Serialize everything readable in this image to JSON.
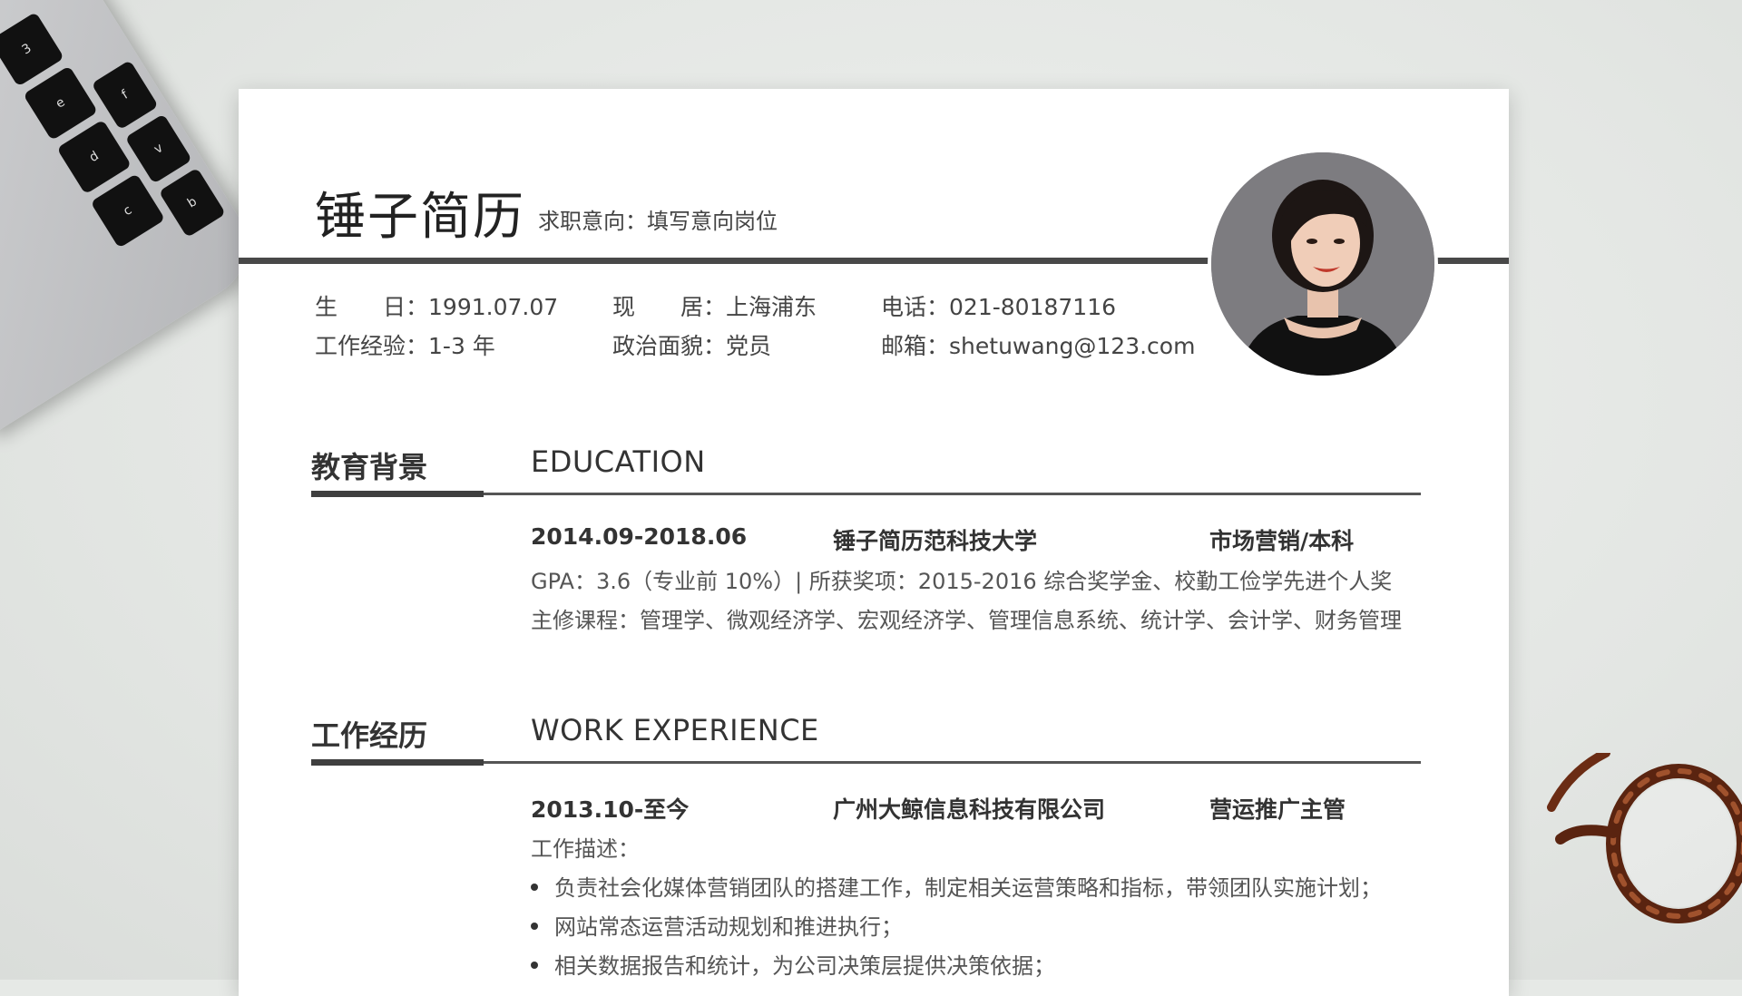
{
  "header": {
    "name": "锤子简历",
    "intent": "求职意向：填写意向岗位"
  },
  "info": {
    "birthday_label": "生　　日：",
    "birthday": "1991.07.07",
    "residence_label": "现　　居：",
    "residence": "上海浦东",
    "phone_label": "电话：",
    "phone": "021-80187116",
    "experience_label": "工作经验：",
    "experience": "1-3 年",
    "politics_label": "政治面貌：",
    "politics": "党员",
    "email_label": "邮箱：",
    "email": "shetuwang@123.com"
  },
  "education": {
    "title_cn": "教育背景",
    "title_en": "EDUCATION",
    "period": "2014.09-2018.06",
    "school": "锤子简历范科技大学",
    "major": "市场营销/本科",
    "gpa_line": "GPA：3.6（专业前 10%）| 所获奖项：2015-2016 综合奖学金、校勤工俭学先进个人奖",
    "courses_line": "主修课程：管理学、微观经济学、宏观经济学、管理信息系统、统计学、会计学、财务管理"
  },
  "work": {
    "title_cn": "工作经历",
    "title_en": "WORK EXPERIENCE",
    "period": "2013.10-至今",
    "company": "广州大鲸信息科技有限公司",
    "position": "营运推广主管",
    "desc_label": "工作描述：",
    "bullets": [
      "负责社会化媒体营销团队的搭建工作，制定相关运营策略和指标，带领团队实施计划；",
      "网站常态运营活动规划和推进执行；",
      "相关数据报告和统计，为公司决策层提供决策依据；"
    ]
  },
  "laptop_keys": [
    "3",
    "e",
    "d",
    "c",
    "f",
    "v",
    "b"
  ],
  "colors": {
    "background": "#e6e9e6",
    "paper": "#ffffff",
    "rule": "#484848",
    "text": "#333333"
  },
  "icons": [
    "laptop-keyboard",
    "eyeglasses",
    "profile-photo"
  ]
}
